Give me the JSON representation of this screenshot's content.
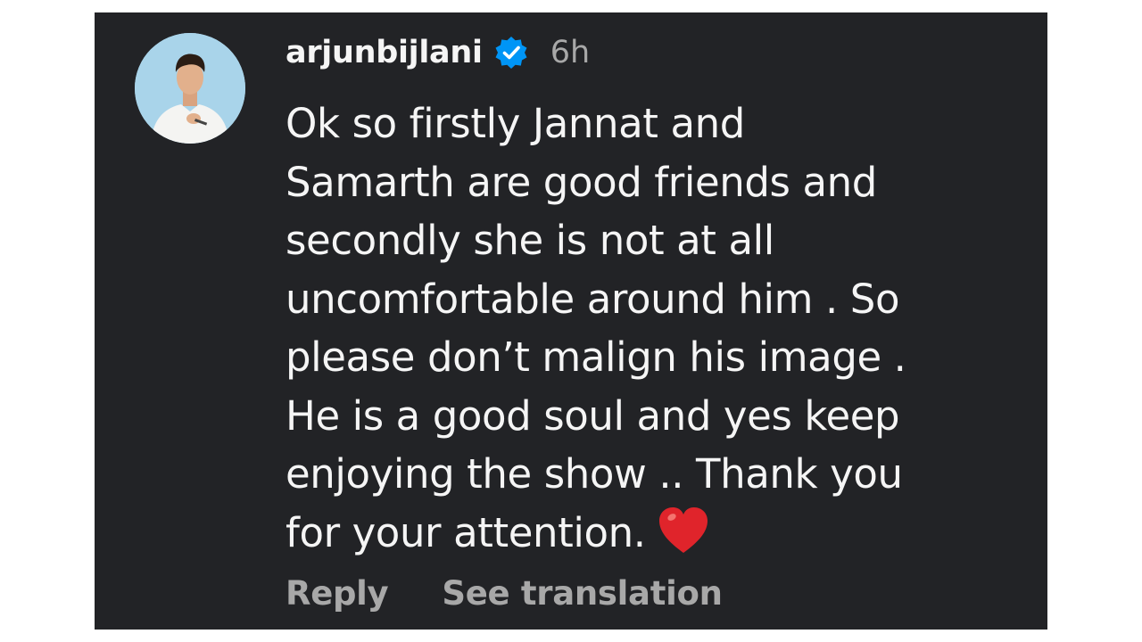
{
  "comment": {
    "username": "arjunbijlani",
    "verified_icon": "verified-badge-icon",
    "time_ago": "6h",
    "text_lines": [
      "Ok so firstly Jannat and",
      "Samarth are good friends and",
      "secondly she is not at all",
      "uncomfortable around him . So",
      "please don’t malign his image .",
      "He is a good soul and yes keep",
      "enjoying the show .. Thank you",
      "for your attention."
    ],
    "emoji": "heart-icon",
    "actions": {
      "reply_label": "Reply",
      "translate_label": "See translation"
    }
  },
  "colors": {
    "background": "#222326",
    "text": "#f5f5f5",
    "muted": "#a8a8a8",
    "verified": "#0095f6",
    "heart": "#e0242b"
  }
}
